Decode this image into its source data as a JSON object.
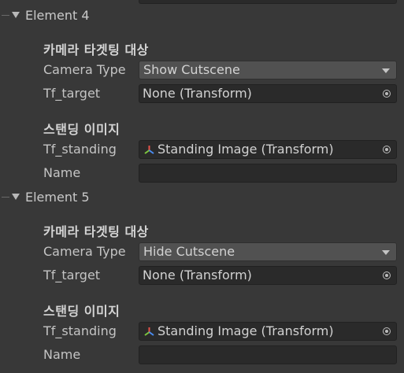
{
  "elements": [
    {
      "header": "Element 4",
      "camera_section_title": "카메라 타겟팅 대상",
      "camera_type_label": "Camera Type",
      "camera_type_value": "Show Cutscene",
      "tf_target_label": "Tf_target",
      "tf_target_value": "None (Transform)",
      "standing_section_title": "스탠딩 이미지",
      "tf_standing_label": "Tf_standing",
      "tf_standing_value": "Standing Image (Transform)",
      "name_label": "Name",
      "name_value": ""
    },
    {
      "header": "Element 5",
      "camera_section_title": "카메라 타겟팅 대상",
      "camera_type_label": "Camera Type",
      "camera_type_value": "Hide Cutscene",
      "tf_target_label": "Tf_target",
      "tf_target_value": "None (Transform)",
      "standing_section_title": "스탠딩 이미지",
      "tf_standing_label": "Tf_standing",
      "tf_standing_value": "Standing Image (Transform)",
      "name_label": "Name",
      "name_value": ""
    }
  ],
  "icons": {
    "foldout": "chevron-down-icon",
    "object_picker": "object-picker-icon",
    "transform": "transform-icon",
    "dropdown": "dropdown-caret-icon"
  },
  "colors": {
    "background": "#383838",
    "field_dark": "#2a2a2a",
    "dropdown_bg": "#515151",
    "text": "#c4c4c4",
    "axis_x": "#e8534a",
    "axis_y": "#7ec63f",
    "axis_z": "#4a8cf0"
  }
}
